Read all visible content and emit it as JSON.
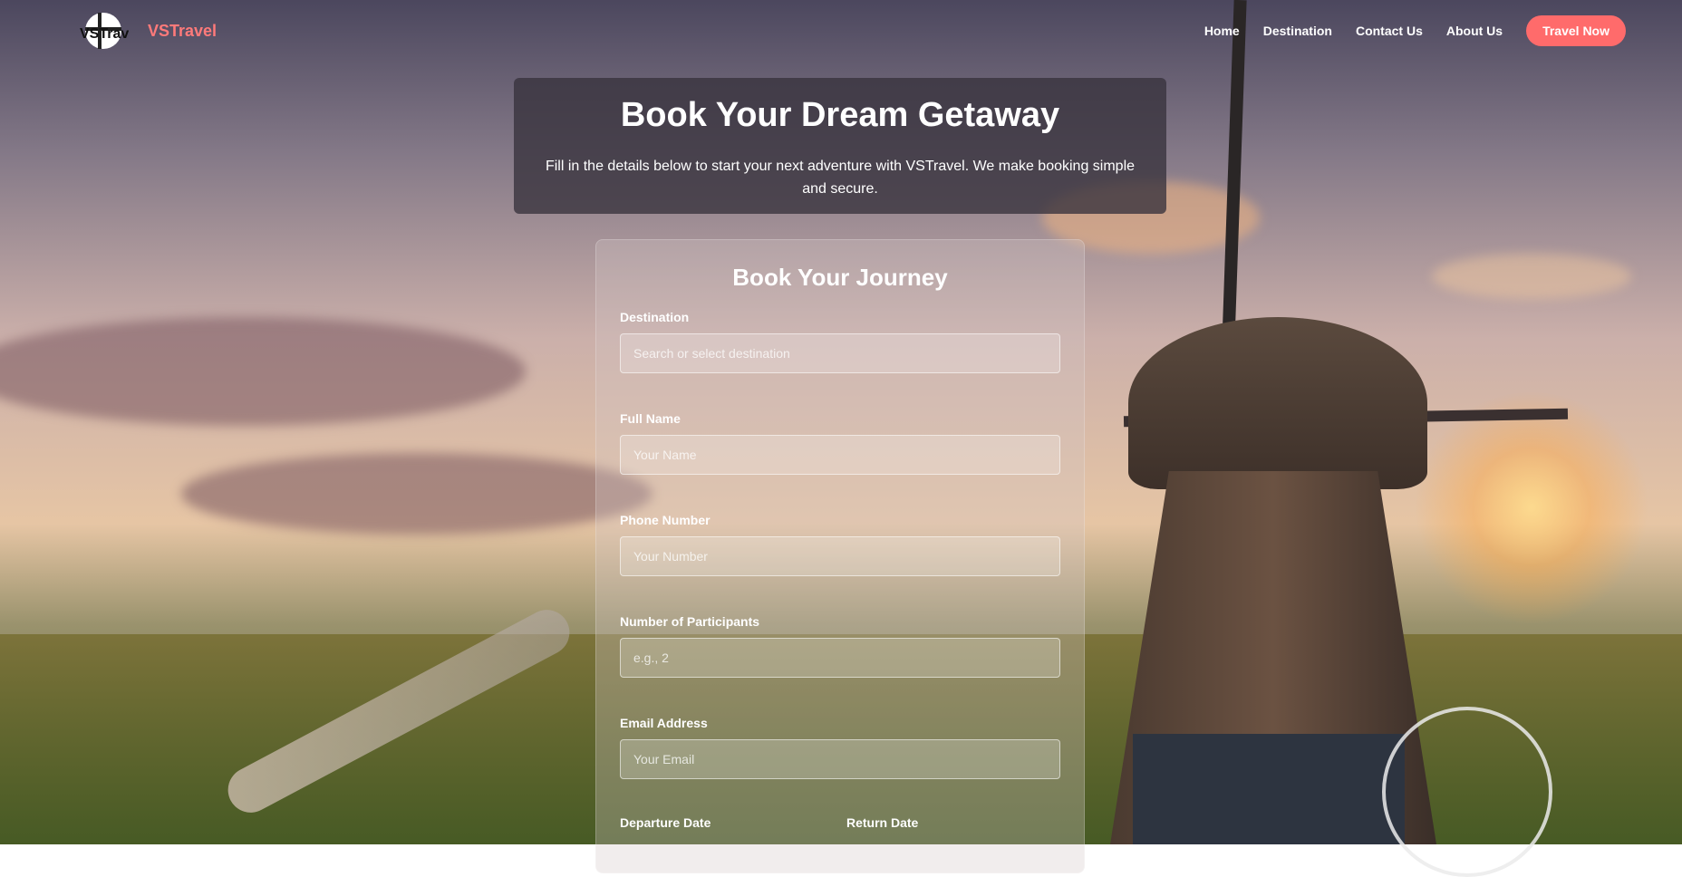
{
  "brand": {
    "name": "VSTravel",
    "logo_text": "VSTravel"
  },
  "nav": {
    "items": [
      "Home",
      "Destination",
      "Contact Us",
      "About Us"
    ],
    "cta": "Travel Now"
  },
  "hero": {
    "title": "Book Your Dream Getaway",
    "subtitle": "Fill in the details below to start your next adventure with VSTravel. We make booking simple and secure."
  },
  "form": {
    "title": "Book Your Journey",
    "fields": [
      {
        "label": "Destination",
        "placeholder": "Search or select destination"
      },
      {
        "label": "Full Name",
        "placeholder": "Your Name"
      },
      {
        "label": "Phone Number",
        "placeholder": "Your Number"
      },
      {
        "label": "Number of Participants",
        "placeholder": "e.g., 2"
      },
      {
        "label": "Email Address",
        "placeholder": "Your Email"
      }
    ],
    "departure_label": "Departure Date",
    "return_label": "Return Date"
  },
  "colors": {
    "accent": "#ff6b6b",
    "brand_text": "#ff7a7a"
  }
}
